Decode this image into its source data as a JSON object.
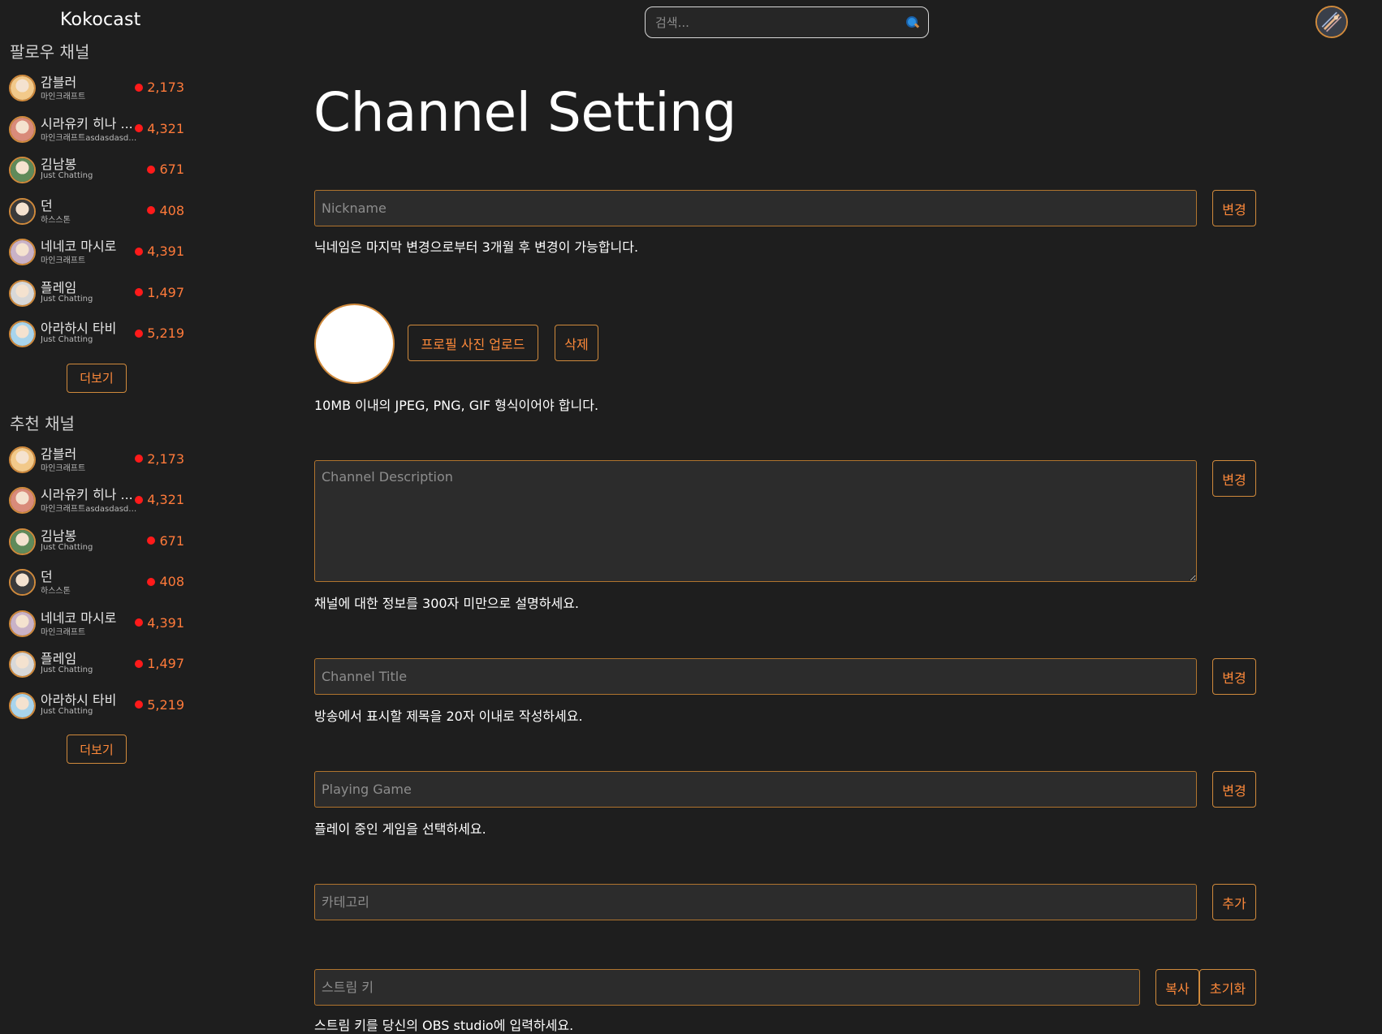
{
  "header": {
    "logo": "Kokocast",
    "search_placeholder": "검색...",
    "search_icon": "magnifier-icon",
    "user_avatar_icon": "user-avatar"
  },
  "sidebar": {
    "followed": {
      "title": "팔로우 채널",
      "more_label": "더보기",
      "channels": [
        {
          "name": "감블러",
          "category": "마인크래프트",
          "viewers": "2,173",
          "color": "#f2c98a"
        },
        {
          "name": "시라유키 히나 ...",
          "category": "마인크래프트asdasdasda...",
          "viewers": "4,321",
          "color": "#d98b7a"
        },
        {
          "name": "김남봉",
          "category": "Just Chatting",
          "viewers": "671",
          "color": "#5f8a5a"
        },
        {
          "name": "던",
          "category": "하스스톤",
          "viewers": "408",
          "color": "#3a3a3a"
        },
        {
          "name": "네네코 마시로",
          "category": "마인크래프트",
          "viewers": "4,391",
          "color": "#c9b2c7"
        },
        {
          "name": "플레임",
          "category": "Just Chatting",
          "viewers": "1,497",
          "color": "#d8d8d8"
        },
        {
          "name": "아라하시 타비",
          "category": "Just Chatting",
          "viewers": "5,219",
          "color": "#a8d4ec"
        }
      ]
    },
    "recommended": {
      "title": "추천 채널",
      "more_label": "더보기",
      "channels": [
        {
          "name": "감블러",
          "category": "마인크래프트",
          "viewers": "2,173",
          "color": "#f2c98a"
        },
        {
          "name": "시라유키 히나 ...",
          "category": "마인크래프트asdasdasda...",
          "viewers": "4,321",
          "color": "#d98b7a"
        },
        {
          "name": "김남봉",
          "category": "Just Chatting",
          "viewers": "671",
          "color": "#5f8a5a"
        },
        {
          "name": "던",
          "category": "하스스톤",
          "viewers": "408",
          "color": "#3a3a3a"
        },
        {
          "name": "네네코 마시로",
          "category": "마인크래프트",
          "viewers": "4,391",
          "color": "#c9b2c7"
        },
        {
          "name": "플레임",
          "category": "Just Chatting",
          "viewers": "1,497",
          "color": "#d8d8d8"
        },
        {
          "name": "아라하시 타비",
          "category": "Just Chatting",
          "viewers": "5,219",
          "color": "#a8d4ec"
        }
      ]
    }
  },
  "main": {
    "title": "Channel Setting",
    "nickname": {
      "placeholder": "Nickname",
      "button": "변경",
      "hint": "닉네임은 마지막 변경으로부터 3개월 후 변경이 가능합니다."
    },
    "profile": {
      "upload_button": "프로필 사진 업로드",
      "delete_button": "삭제",
      "hint": "10MB 이내의 JPEG, PNG, GIF 형식이어야 합니다."
    },
    "description": {
      "placeholder": "Channel Description",
      "button": "변경",
      "hint": "채널에 대한 정보를 300자 미만으로 설명하세요."
    },
    "channel_title": {
      "placeholder": "Channel Title",
      "button": "변경",
      "hint": "방송에서 표시할 제목을 20자 이내로 작성하세요."
    },
    "game": {
      "placeholder": "Playing Game",
      "button": "변경",
      "hint": "플레이 중인 게임을 선택하세요."
    },
    "category": {
      "placeholder": "카테고리",
      "button": "추가"
    },
    "stream_key": {
      "placeholder": "스트림 키",
      "copy_button": "복사",
      "reset_button": "초기화",
      "hint": "스트림 키를 당신의 OBS studio에 입력하세요."
    }
  },
  "colors": {
    "background": "#1e1e1e",
    "accent": "#d08a3c",
    "accent_text": "#ff8a3a",
    "live_dot": "#ff1a1a"
  }
}
